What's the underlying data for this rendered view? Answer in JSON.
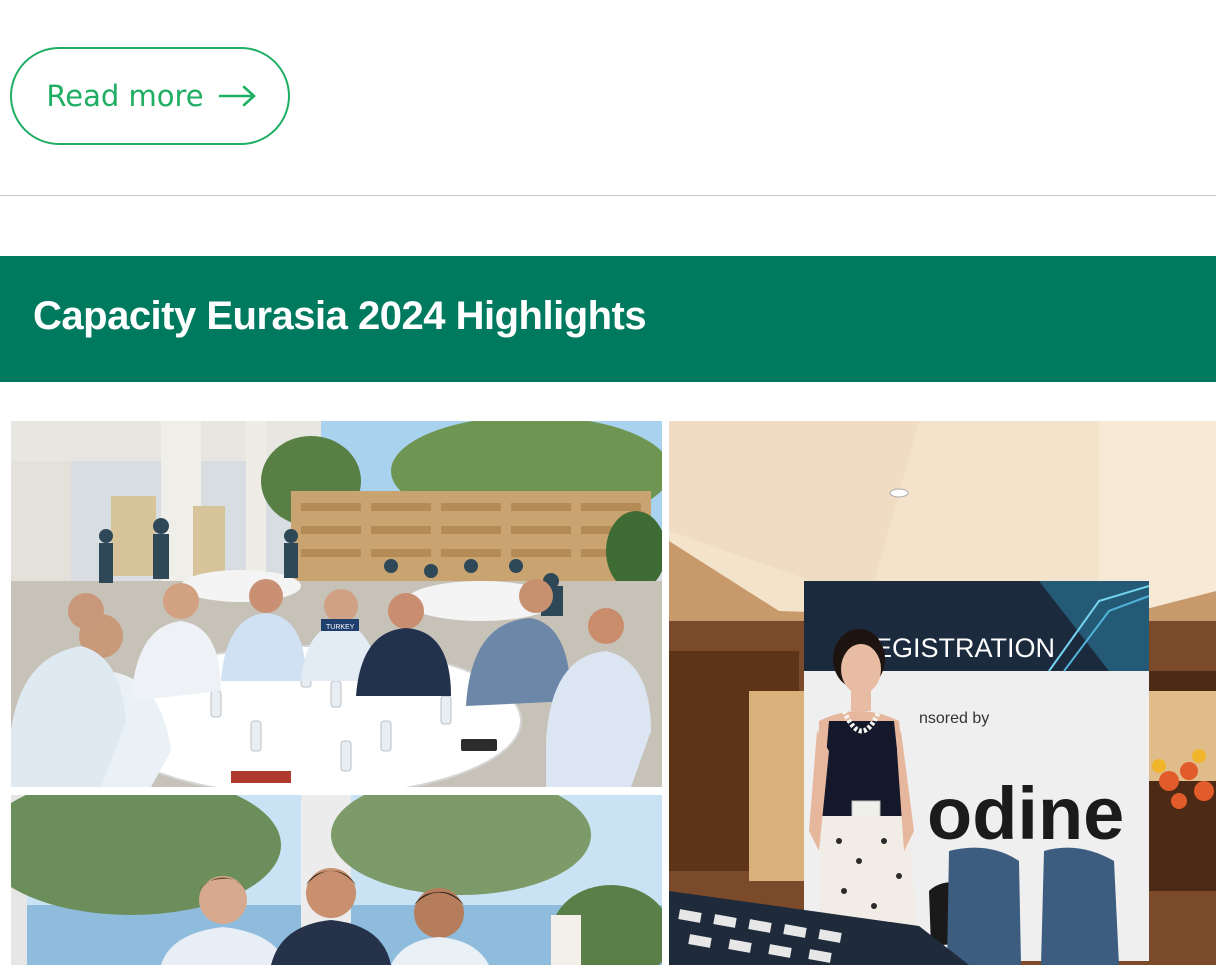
{
  "read_more": {
    "label": "Read more",
    "icon": "arrow-right-icon",
    "color": "#1fae62"
  },
  "section": {
    "title": "Capacity Eurasia 2024 Highlights",
    "banner_color": "#007a5e"
  },
  "photos": {
    "registration_sign": {
      "heading": "EGISTRATION",
      "sponsor_line": "nsored by",
      "sponsor_name": "odine"
    },
    "badge_text": "TURKEY"
  }
}
